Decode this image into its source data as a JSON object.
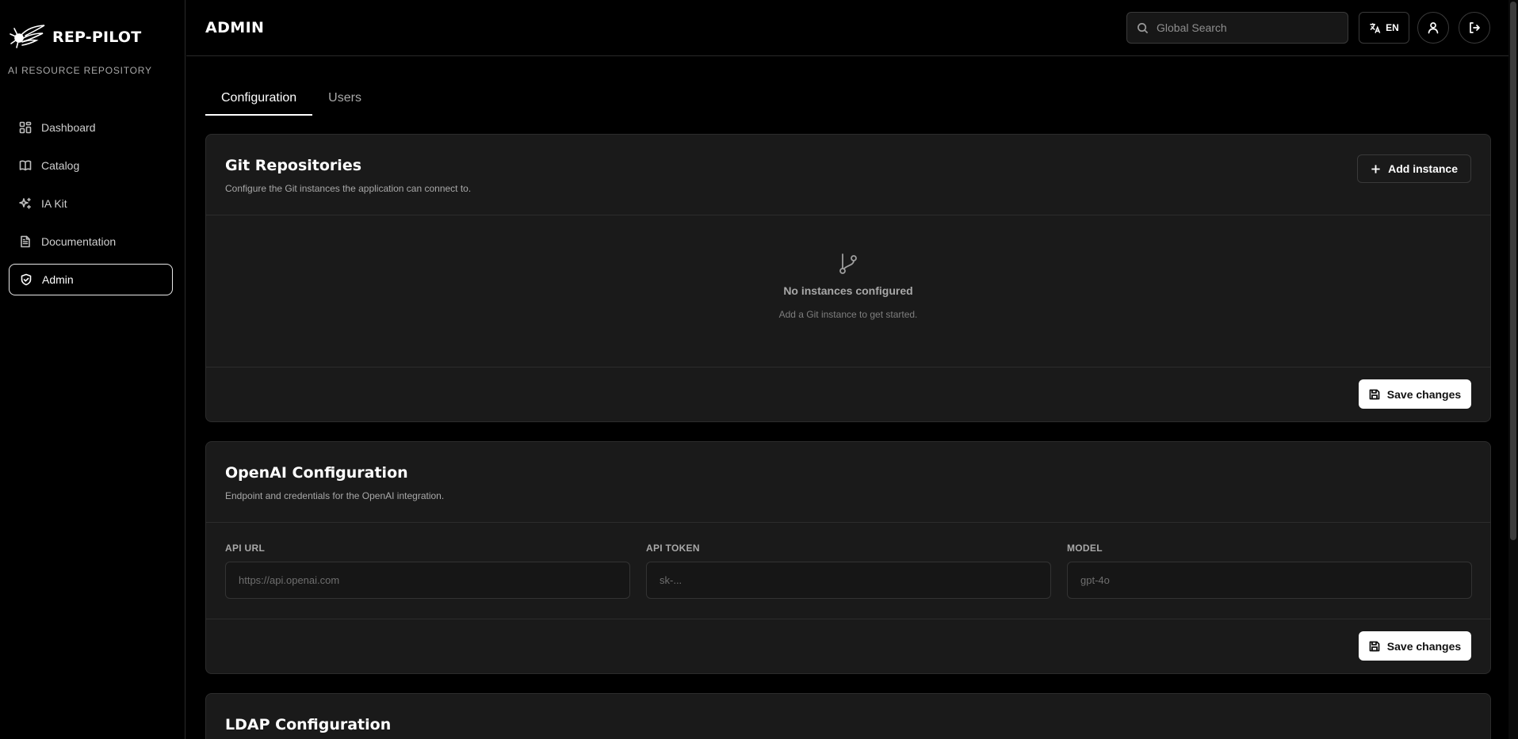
{
  "brand": {
    "name": "REP-PILOT",
    "subtitle": "AI RESOURCE REPOSITORY"
  },
  "sidebar": {
    "items": [
      {
        "label": "Dashboard",
        "icon": "dashboard-icon"
      },
      {
        "label": "Catalog",
        "icon": "book-icon"
      },
      {
        "label": "IA Kit",
        "icon": "sparkles-icon"
      },
      {
        "label": "Documentation",
        "icon": "document-icon"
      },
      {
        "label": "Admin",
        "icon": "shield-icon",
        "active": true
      }
    ]
  },
  "header": {
    "title": "ADMIN",
    "search_placeholder": "Global Search",
    "language": "EN"
  },
  "tabs": [
    {
      "label": "Configuration",
      "active": true
    },
    {
      "label": "Users",
      "active": false
    }
  ],
  "git": {
    "title": "Git Repositories",
    "description": "Configure the Git instances the application can connect to.",
    "add_label": "Add instance",
    "empty_title": "No instances configured",
    "empty_sub": "Add a Git instance to get started.",
    "save_label": "Save changes"
  },
  "openai": {
    "title": "OpenAI Configuration",
    "description": "Endpoint and credentials for the OpenAI integration.",
    "fields": [
      {
        "label": "API URL",
        "placeholder": "https://api.openai.com",
        "value": ""
      },
      {
        "label": "API TOKEN",
        "placeholder": "sk-...",
        "value": ""
      },
      {
        "label": "MODEL",
        "placeholder": "gpt-4o",
        "value": ""
      }
    ],
    "save_label": "Save changes"
  },
  "ldap": {
    "title": "LDAP Configuration"
  },
  "colors": {
    "background": "#000000",
    "card": "#1a1a1a",
    "accent": "#ffffff"
  }
}
